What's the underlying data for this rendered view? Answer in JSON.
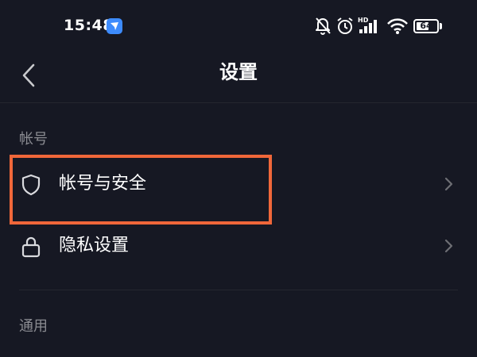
{
  "status_bar": {
    "time": "15:48",
    "network_label": "HD",
    "battery_level": "64",
    "battery_fraction": 0.64,
    "icons": [
      "app-notification-icon",
      "mute-bell-icon",
      "alarm-clock-icon",
      "signal-icon",
      "wifi-icon",
      "battery-icon"
    ]
  },
  "nav": {
    "title": "设置",
    "back_icon": "back-chevron-icon"
  },
  "sections": {
    "account": {
      "header": "帐号",
      "items": [
        {
          "label": "帐号与安全",
          "icon": "shield-icon",
          "highlighted": true
        },
        {
          "label": "隐私设置",
          "icon": "lock-icon",
          "highlighted": false
        }
      ]
    },
    "general": {
      "header": "通用"
    }
  },
  "colors": {
    "background": "#161823",
    "text_primary": "#ffffff",
    "text_secondary": "#8a8b91",
    "divider": "#25262f",
    "highlight": "#f0673a",
    "app_badge": "#3d8bfd"
  }
}
